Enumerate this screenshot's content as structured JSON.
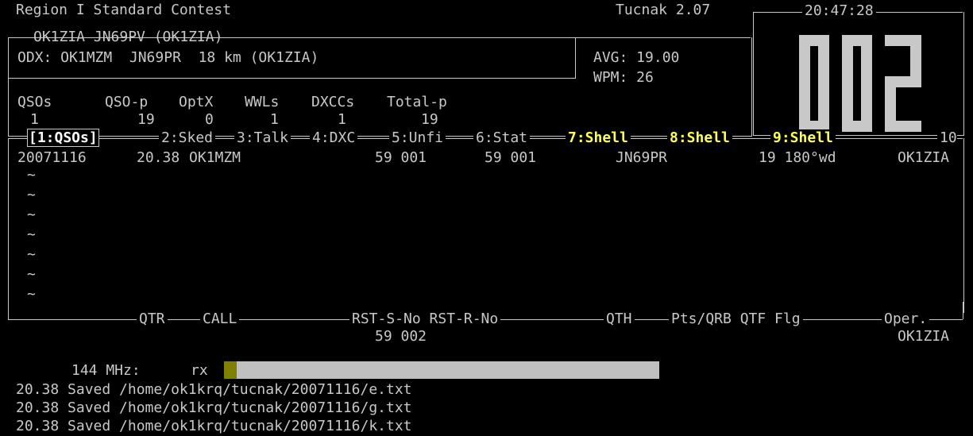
{
  "header": {
    "contest_name": "Region I Standard Contest",
    "app_version": "Tucnak 2.07",
    "clock": "20:47:28"
  },
  "station_box": {
    "title": "OK1ZIA JN69PV (OK1ZIA)",
    "odx": "ODX: OK1MZM  JN69PR  18 km (OK1ZIA)",
    "avg": "AVG: 19.00",
    "wpm": "WPM: 26"
  },
  "stats": {
    "headers": [
      "QSOs",
      "QSO-p",
      "OptX",
      "WWLs",
      "DXCCs",
      "Total-p"
    ],
    "values": [
      "1",
      "19",
      "0",
      "1",
      "1",
      "19"
    ]
  },
  "big_counter": "002",
  "tabs": [
    {
      "label": "[1:QSOs]",
      "active": true
    },
    {
      "label": "2:Sked"
    },
    {
      "label": "3:Talk"
    },
    {
      "label": "4:DXC"
    },
    {
      "label": "5:Unfi"
    },
    {
      "label": "6:Stat"
    },
    {
      "label": "7:Shell"
    },
    {
      "label": "8:Shell"
    },
    {
      "label": "9:Shell"
    },
    {
      "label": "10"
    }
  ],
  "qso_rows": [
    {
      "date": "20071116",
      "time": "20.38",
      "call": "OK1MZM",
      "rst_s": "59 001",
      "rst_r": "59 001",
      "qth": "JN69PR",
      "pts_qrb_qtf": "19 180°wd",
      "operator": "OK1ZIA"
    }
  ],
  "empty_row_marker": "~",
  "columns": {
    "qtr": "QTR",
    "call": "CALL",
    "rst": "RST-S-No RST-R-No",
    "qth": "QTH",
    "pts": "Pts/QRB QTF Flg",
    "oper": "Oper."
  },
  "entry": {
    "rst_s_no": "59 002",
    "operator": "OK1ZIA"
  },
  "band": {
    "label": "144 MHz:",
    "mode": "rx",
    "level_percent": 3
  },
  "log": [
    "20.38 Saved /home/ok1krq/tucnak/20071116/e.txt",
    "20.38 Saved /home/ok1krq/tucnak/20071116/g.txt",
    "20.38 Saved /home/ok1krq/tucnak/20071116/k.txt"
  ],
  "colors": {
    "background": "#000000",
    "text": "#c8c8c8",
    "highlight": "#ffff55",
    "bar": "#c0c0c0",
    "bar_level": "#808000"
  }
}
